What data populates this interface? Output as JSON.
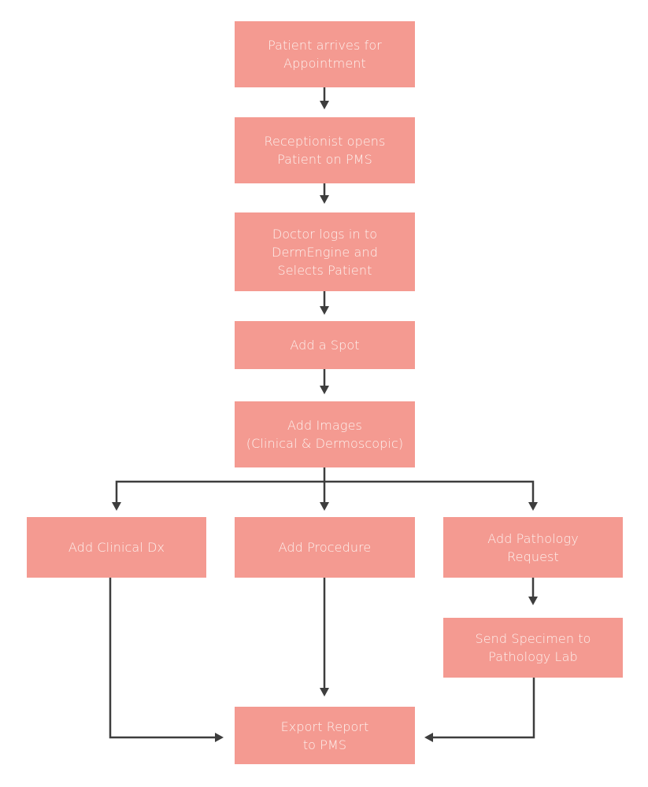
{
  "colors": {
    "box_fill": "#f49a91",
    "box_text": "#fdf2ef",
    "connector": "#3d3d3d"
  },
  "nodes": {
    "arrival": {
      "label": "Patient arrives for\nAppointment"
    },
    "reception": {
      "label": "Receptionist opens\nPatient on PMS"
    },
    "doctor": {
      "label": "Doctor logs in to\nDermEngine and\nSelects Patient"
    },
    "spot": {
      "label": "Add a Spot"
    },
    "images": {
      "label": "Add Images\n(Clinical & Dermoscopic)"
    },
    "clinical_dx": {
      "label": "Add Clinical Dx"
    },
    "procedure": {
      "label": "Add Procedure"
    },
    "pathology": {
      "label": "Add Pathology\nRequest"
    },
    "specimen": {
      "label": "Send Specimen to\nPathology Lab"
    },
    "export": {
      "label": "Export Report\nto PMS"
    }
  },
  "edges": [
    [
      "arrival",
      "reception"
    ],
    [
      "reception",
      "doctor"
    ],
    [
      "doctor",
      "spot"
    ],
    [
      "spot",
      "images"
    ],
    [
      "images",
      "clinical_dx"
    ],
    [
      "images",
      "procedure"
    ],
    [
      "images",
      "pathology"
    ],
    [
      "pathology",
      "specimen"
    ],
    [
      "clinical_dx",
      "export"
    ],
    [
      "procedure",
      "export"
    ],
    [
      "specimen",
      "export"
    ]
  ]
}
